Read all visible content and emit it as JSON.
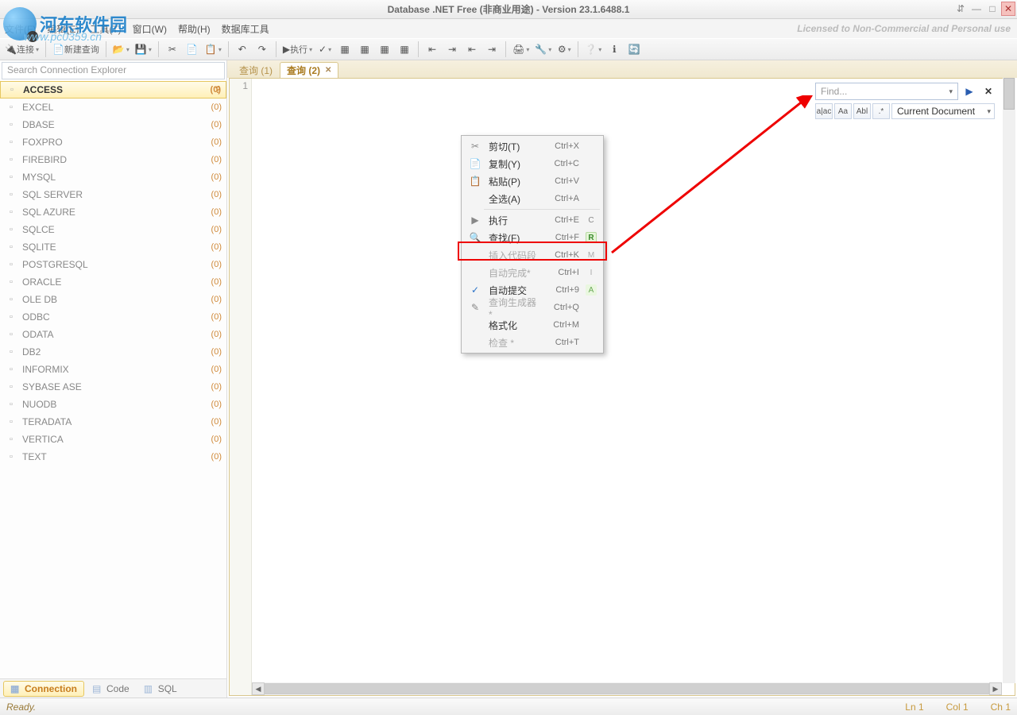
{
  "title": "Database .NET Free (非商业用途)  -  Version 23.1.6488.1",
  "license_note": "Licensed to Non-Commercial and Personal use",
  "menubar": [
    "文件(F)",
    "编辑(E)",
    "工具(T)",
    "窗口(W)",
    "帮助(H)",
    "数据库工具"
  ],
  "toolbar": {
    "connect": "连接",
    "new_query": "新建查询",
    "execute": "执行"
  },
  "search_placeholder": "Search Connection Explorer",
  "connections": [
    {
      "name": "ACCESS",
      "count": "(0)",
      "active": true
    },
    {
      "name": "EXCEL",
      "count": "(0)"
    },
    {
      "name": "DBASE",
      "count": "(0)"
    },
    {
      "name": "FOXPRO",
      "count": "(0)"
    },
    {
      "name": "FIREBIRD",
      "count": "(0)"
    },
    {
      "name": "MYSQL",
      "count": "(0)"
    },
    {
      "name": "SQL SERVER",
      "count": "(0)"
    },
    {
      "name": "SQL AZURE",
      "count": "(0)"
    },
    {
      "name": "SQLCE",
      "count": "(0)"
    },
    {
      "name": "SQLITE",
      "count": "(0)"
    },
    {
      "name": "POSTGRESQL",
      "count": "(0)"
    },
    {
      "name": "ORACLE",
      "count": "(0)"
    },
    {
      "name": "OLE DB",
      "count": "(0)"
    },
    {
      "name": "ODBC",
      "count": "(0)"
    },
    {
      "name": "ODATA",
      "count": "(0)"
    },
    {
      "name": "DB2",
      "count": "(0)"
    },
    {
      "name": "INFORMIX",
      "count": "(0)"
    },
    {
      "name": "SYBASE ASE",
      "count": "(0)"
    },
    {
      "name": "NUODB",
      "count": "(0)"
    },
    {
      "name": "TERADATA",
      "count": "(0)"
    },
    {
      "name": "VERTICA",
      "count": "(0)"
    },
    {
      "name": "TEXT",
      "count": "(0)"
    }
  ],
  "bottom_tabs": {
    "connection": "Connection",
    "code": "Code",
    "sql": "SQL"
  },
  "editor_tabs": [
    {
      "label": "查询  (1)",
      "active": false
    },
    {
      "label": "查询  (2)",
      "active": true
    }
  ],
  "gutter_line": "1",
  "find": {
    "placeholder": "Find...",
    "scope": "Current Document",
    "opts": [
      "a|ac",
      "Aa",
      "Abl",
      ".*"
    ]
  },
  "context_menu": [
    {
      "icon": "✂",
      "label": "剪切(T)",
      "shortcut": "Ctrl+X"
    },
    {
      "icon": "📄",
      "label": "复制(Y)",
      "shortcut": "Ctrl+C"
    },
    {
      "icon": "📋",
      "label": "粘贴(P)",
      "shortcut": "Ctrl+V"
    },
    {
      "icon": "",
      "label": "全选(A)",
      "shortcut": "Ctrl+A"
    },
    {
      "sep": true
    },
    {
      "icon": "▶",
      "label": "执行",
      "shortcut": "Ctrl+E",
      "badge": "C",
      "bcls": "c"
    },
    {
      "icon": "🔍",
      "label": "查找(F)",
      "shortcut": "Ctrl+F",
      "badge": "R",
      "bcls": "r",
      "highlight": true
    },
    {
      "icon": "",
      "label": "插入代码段",
      "shortcut": "Ctrl+K",
      "badge": "M",
      "bcls": "m",
      "disabled": true
    },
    {
      "icon": "",
      "label": "自动完成*",
      "shortcut": "Ctrl+I",
      "badge": "I",
      "bcls": "i",
      "disabled": true
    },
    {
      "check": "✓",
      "label": "自动提交",
      "shortcut": "Ctrl+9",
      "badge": "A",
      "bcls": "a"
    },
    {
      "icon": "✎",
      "label": "查询生成器*",
      "shortcut": "Ctrl+Q",
      "disabled": true
    },
    {
      "icon": "",
      "label": "格式化",
      "shortcut": "Ctrl+M"
    },
    {
      "icon": "",
      "label": "检查 *",
      "shortcut": "Ctrl+T",
      "disabled": true
    }
  ],
  "status": {
    "ready": "Ready.",
    "ln": "Ln 1",
    "col": "Col 1",
    "ch": "Ch 1"
  },
  "watermark": {
    "brand": "河东软件园",
    "url": "www.pc0359.cn"
  }
}
